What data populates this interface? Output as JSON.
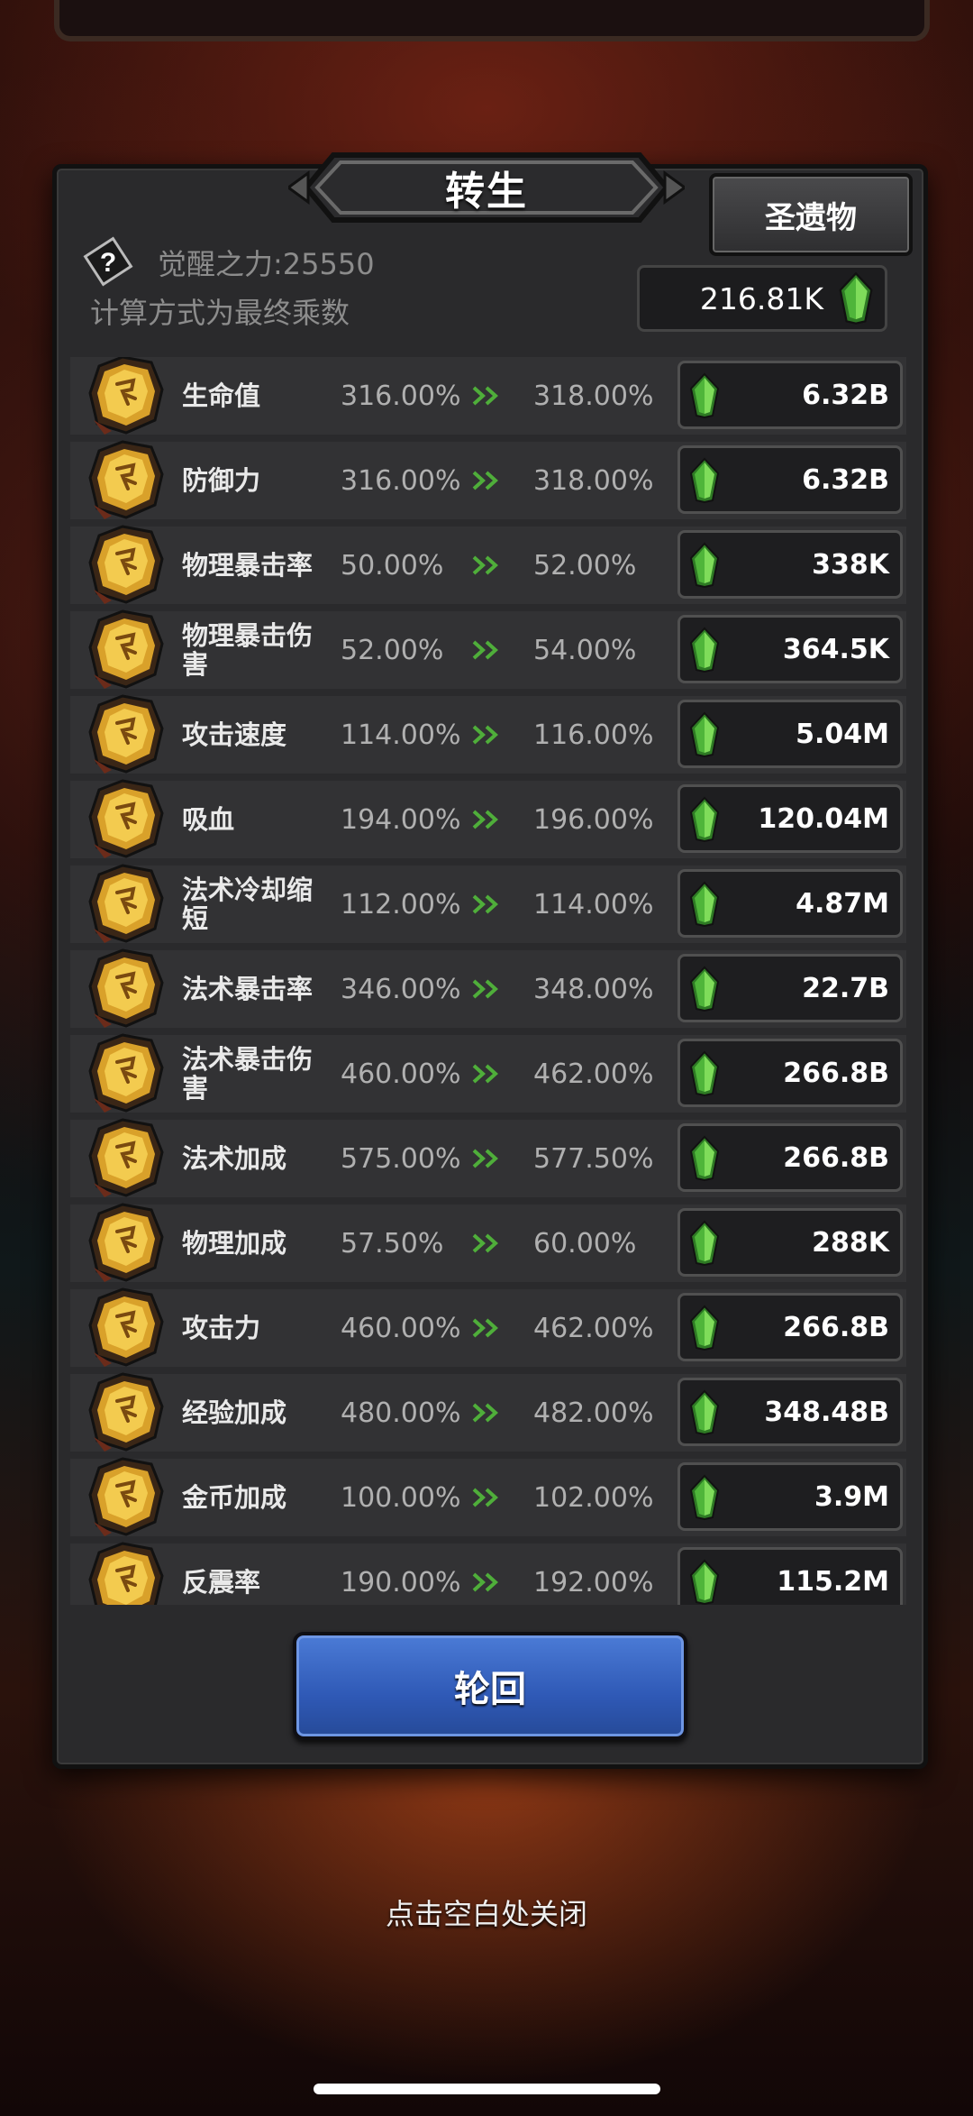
{
  "header": {
    "title": "转生",
    "relic_button": "圣遗物",
    "awaken_power": "觉醒之力:25550",
    "calc_note": "计算方式为最终乘数",
    "currency_amount": "216.81K"
  },
  "stats": [
    {
      "name": "生命值",
      "current": "316.00%",
      "next": "318.00%",
      "cost": "6.32B"
    },
    {
      "name": "防御力",
      "current": "316.00%",
      "next": "318.00%",
      "cost": "6.32B"
    },
    {
      "name": "物理暴击率",
      "current": "50.00%",
      "next": "52.00%",
      "cost": "338K"
    },
    {
      "name": "物理暴击伤害",
      "current": "52.00%",
      "next": "54.00%",
      "cost": "364.5K"
    },
    {
      "name": "攻击速度",
      "current": "114.00%",
      "next": "116.00%",
      "cost": "5.04M"
    },
    {
      "name": "吸血",
      "current": "194.00%",
      "next": "196.00%",
      "cost": "120.04M"
    },
    {
      "name": "法术冷却缩短",
      "current": "112.00%",
      "next": "114.00%",
      "cost": "4.87M"
    },
    {
      "name": "法术暴击率",
      "current": "346.00%",
      "next": "348.00%",
      "cost": "22.7B"
    },
    {
      "name": "法术暴击伤害",
      "current": "460.00%",
      "next": "462.00%",
      "cost": "266.8B"
    },
    {
      "name": "法术加成",
      "current": "575.00%",
      "next": "577.50%",
      "cost": "266.8B"
    },
    {
      "name": "物理加成",
      "current": "57.50%",
      "next": "60.00%",
      "cost": "288K"
    },
    {
      "name": "攻击力",
      "current": "460.00%",
      "next": "462.00%",
      "cost": "266.8B"
    },
    {
      "name": "经验加成",
      "current": "480.00%",
      "next": "482.00%",
      "cost": "348.48B"
    },
    {
      "name": "金币加成",
      "current": "100.00%",
      "next": "102.00%",
      "cost": "3.9M"
    },
    {
      "name": "反震率",
      "current": "190.00%",
      "next": "192.00%",
      "cost": "115.2M"
    }
  ],
  "footer": {
    "rebirth_button": "轮回",
    "close_hint": "点击空白处关闭"
  },
  "colors": {
    "panel": "#2a2a2c",
    "row": "#323234",
    "gem": "#5fc24a",
    "arrow": "#4fae3a",
    "rebirth_button": "#2f59b6"
  },
  "icons": {
    "stat_badge": "gold-rune-badge-icon",
    "gem": "green-crystal-icon",
    "arrow": "double-chevron-right-icon",
    "help": "question-mark-icon"
  }
}
